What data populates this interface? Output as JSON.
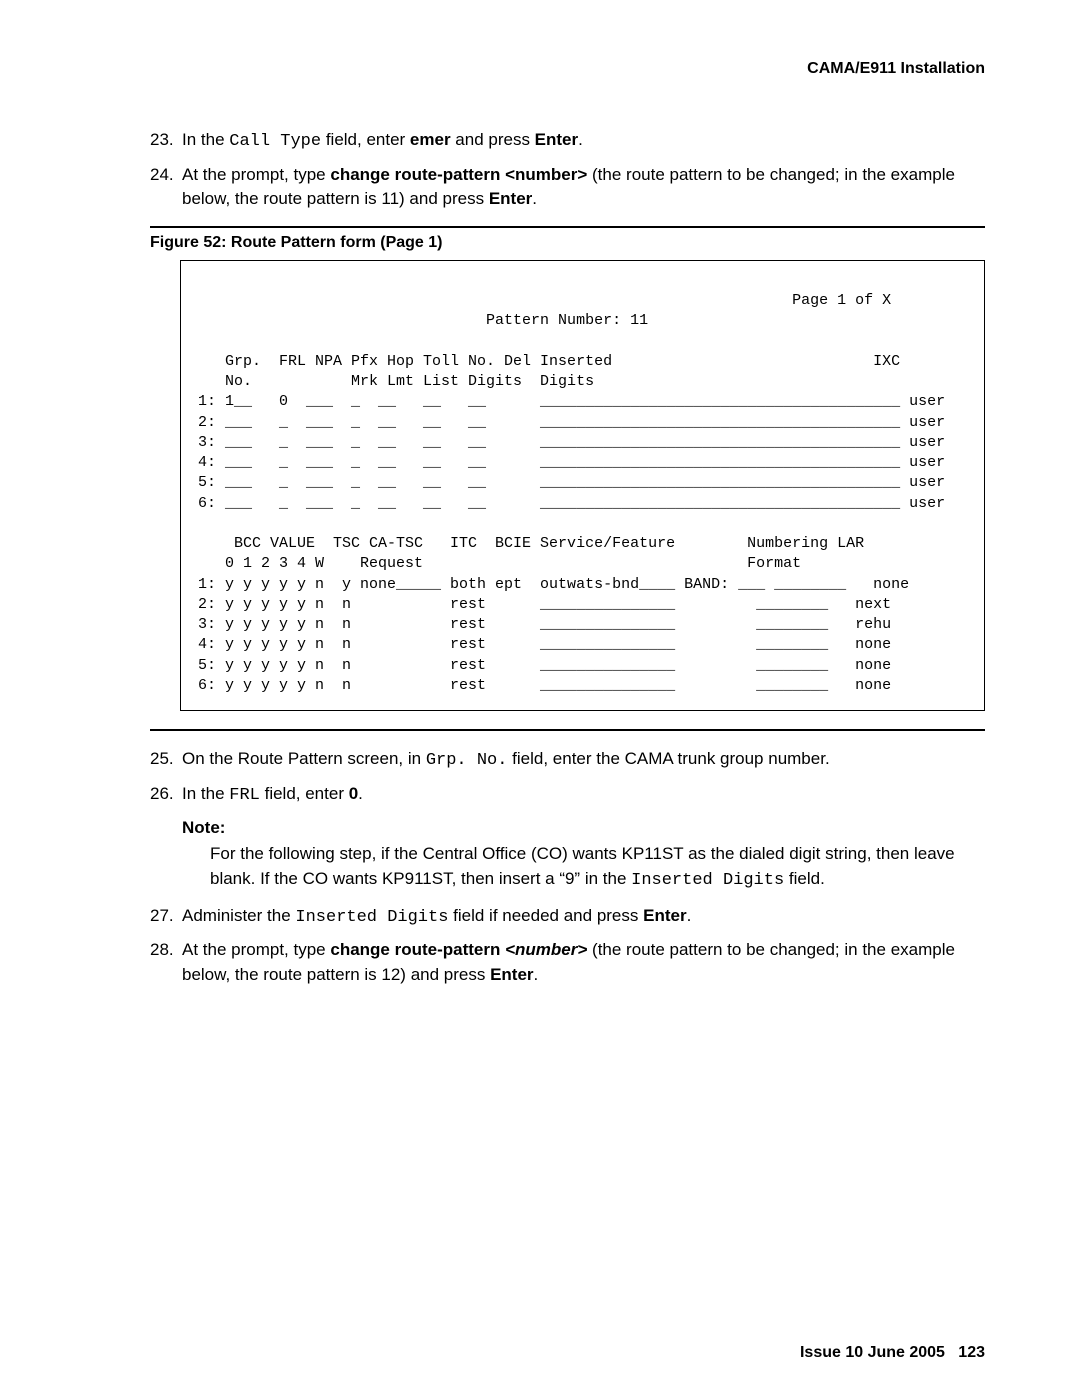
{
  "header": {
    "title": "CAMA/E911 Installation"
  },
  "steps_a": [
    {
      "n": "23.",
      "pre": "In the ",
      "mono": "Call Type",
      "mid": " field, enter ",
      "bold": "emer",
      "mid2": " and press ",
      "bold2": "Enter",
      "post": "."
    },
    {
      "n": "24.",
      "pre": "At the prompt, type ",
      "bold": "change route-pattern <number>",
      "mid": " (the route pattern to be changed; in the example below, the route pattern is 11) and press ",
      "bold2": "Enter",
      "post": "."
    }
  ],
  "figure": {
    "caption": "Figure 52: Route Pattern form (Page 1)"
  },
  "screen": {
    "page_line": "                                                                   Page 1 of X",
    "pattern_line": "                                 Pattern Number: 11",
    "hdr1": "    Grp.  FRL NPA Pfx Hop Toll No. Del Inserted                             IXC",
    "hdr2": "    No.           Mrk Lmt List Digits  Digits",
    "r1": " 1: 1__   0  ___  _  __   __   __      ________________________________________ user",
    "r2": " 2: ___   _  ___  _  __   __   __      ________________________________________ user",
    "r3": " 3: ___   _  ___  _  __   __   __      ________________________________________ user",
    "r4": " 4: ___   _  ___  _  __   __   __      ________________________________________ user",
    "r5": " 5: ___   _  ___  _  __   __   __      ________________________________________ user",
    "r6": " 6: ___   _  ___  _  __   __   __      ________________________________________ user",
    "mid1": "     BCC VALUE  TSC CA-TSC   ITC  BCIE Service/Feature        Numbering LAR",
    "mid2": "    0 1 2 3 4 W    Request                                    Format",
    "b1": " 1: y y y y y n  y none_____ both ept  outwats-bnd____ BAND: ___ ________   none",
    "b2": " 2: y y y y y n  n           rest      _______________         ________   next",
    "b3": " 3: y y y y y n  n           rest      _______________         ________   rehu",
    "b4": " 4: y y y y y n  n           rest      _______________         ________   none",
    "b5": " 5: y y y y y n  n           rest      _______________         ________   none",
    "b6": " 6: y y y y y n  n           rest      _______________         ________   none"
  },
  "steps_b": [
    {
      "n": "25.",
      "pre": "On the Route Pattern screen, in ",
      "mono": "Grp. No.",
      "mid": " field, enter the CAMA trunk group number."
    },
    {
      "n": "26.",
      "pre": "In the ",
      "mono": "FRL",
      "mid": " field, enter ",
      "bold": "0",
      "post": "."
    }
  ],
  "note": {
    "head": "Note:",
    "body_pre": "For the following step, if the Central Office (CO) wants KP11ST as the dialed digit string, then leave blank. If the CO wants KP911ST, then insert a “9” in the ",
    "body_mono": "Inserted Digits",
    "body_post": " field."
  },
  "steps_c": [
    {
      "n": "27.",
      "pre": "Administer the ",
      "mono": "Inserted Digits",
      "mid": " field if needed and press ",
      "bold": "Enter",
      "post": "."
    },
    {
      "n": "28.",
      "pre": "At the prompt, type ",
      "bold": "change route-pattern ",
      "bi": "<number>",
      "mid": " (the route pattern to be changed; in the example below, the route pattern is 12) and press ",
      "bold2": "Enter",
      "post": "."
    }
  ],
  "footer": {
    "issue": "Issue 10   June 2005",
    "page": "123"
  }
}
